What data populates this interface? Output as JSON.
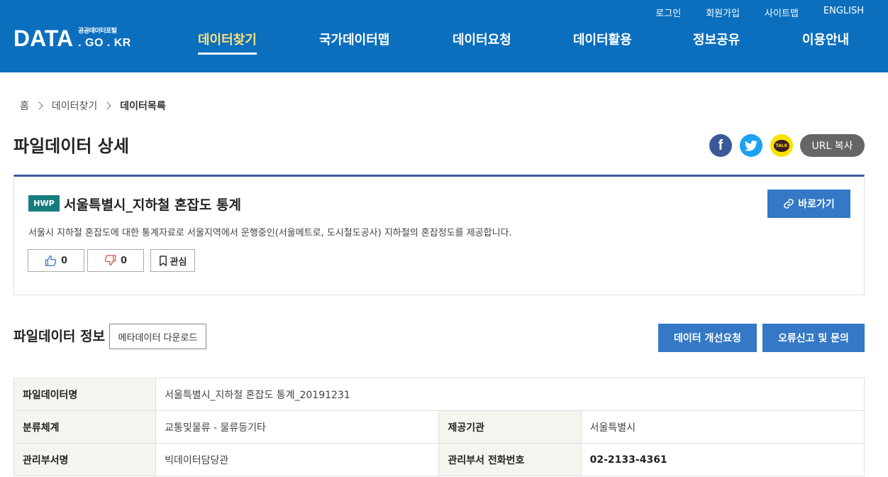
{
  "header": {
    "logo_main": "DATA",
    "logo_sub": "공공데이터포털",
    "logo_domain": ". GO . KR",
    "util_links": [
      "로그인",
      "회원가입",
      "사이트맵",
      "ENGLISH"
    ],
    "nav": [
      "데이터찾기",
      "국가데이터맵",
      "데이터요청",
      "데이터활용",
      "정보공유",
      "이용안내"
    ]
  },
  "breadcrumb": [
    "홈",
    "데이터찾기",
    "데이터목록"
  ],
  "page_title": "파일데이터 상세",
  "share": {
    "facebook_icon": "f",
    "twitter_icon": "twitter-bird",
    "kakao_label": "TALK",
    "url_copy_label": "URL 복사"
  },
  "dataset": {
    "badge": "HWP",
    "title": "서울특별시_지하철 혼잡도 통계",
    "description": "서울시 지하철 혼잡도에 대한 통계자료로 서울지역에서 운행중인(서울메트로, 도시철도공사) 지하철의 혼잡정도를 제공합니다.",
    "goto_label": "바로가기",
    "like_count": "0",
    "dislike_count": "0",
    "interest_label": "관심"
  },
  "section": {
    "title": "파일데이터 정보",
    "meta_download_label": "메타데이터 다운로드",
    "improve_request_label": "데이터 개선요청",
    "error_report_label": "오류신고 및 문의"
  },
  "info_table": {
    "file_name_label": "파일데이터명",
    "file_name_value": "서울특별시_지하철 혼잡도 통계_20191231",
    "category_label": "분류체계",
    "category_value": "교통및물류 - 물류등기타",
    "provider_label": "제공기관",
    "provider_value": "서울특별시",
    "dept_label": "관리부서명",
    "dept_value": "빅데이터담당관",
    "phone_label": "관리부서 전화번호",
    "phone_value": "02-2133-4361"
  },
  "colors": {
    "header_bg": "#0b6fbe",
    "active_nav": "#ffe07a",
    "primary_button": "#3478c6",
    "hwp_badge": "#167d7f",
    "table_header_bg": "#f5f4ef"
  }
}
